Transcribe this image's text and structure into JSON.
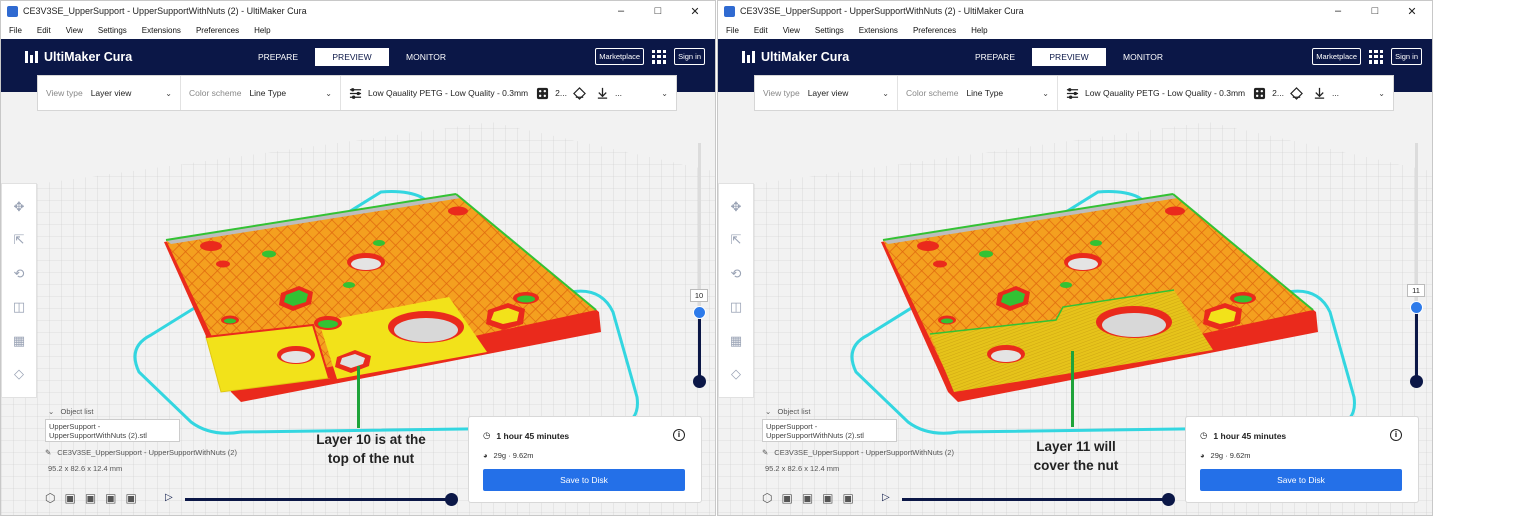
{
  "windows": [
    {
      "title": "CE3V3SE_UpperSupport - UpperSupportWithNuts (2) - UltiMaker Cura",
      "menu": [
        "File",
        "Edit",
        "View",
        "Settings",
        "Extensions",
        "Preferences",
        "Help"
      ],
      "brand": "UltiMaker Cura",
      "stages": [
        "PREPARE",
        "PREVIEW",
        "MONITOR"
      ],
      "marketplace": "Marketplace",
      "signin": "Sign in",
      "view_type_label": "View type",
      "view_type_value": "Layer view",
      "color_scheme_label": "Color scheme",
      "color_scheme_value": "Line Type",
      "profile": "Low Qauality PETG - Low Quality - 0.3mm",
      "support_value": "2...",
      "more": "...",
      "layer": "10",
      "object_list_label": "Object list",
      "object_file": "UpperSupport - UpperSupportWithNuts (2).stl",
      "object_name": "CE3V3SE_UpperSupport - UpperSupportWithNuts (2)",
      "object_dims": "95.2 x 82.6 x 12.4 mm",
      "print_time": "1 hour 45 minutes",
      "material": "29g · 9.62m",
      "save_button": "Save to Disk",
      "annotation_line1": "Layer 10 is at the",
      "annotation_line2": "top of the nut"
    },
    {
      "title": "CE3V3SE_UpperSupport - UpperSupportWithNuts (2) - UltiMaker Cura",
      "menu": [
        "File",
        "Edit",
        "View",
        "Settings",
        "Extensions",
        "Preferences",
        "Help"
      ],
      "brand": "UltiMaker Cura",
      "stages": [
        "PREPARE",
        "PREVIEW",
        "MONITOR"
      ],
      "marketplace": "Marketplace",
      "signin": "Sign in",
      "view_type_label": "View type",
      "view_type_value": "Layer view",
      "color_scheme_label": "Color scheme",
      "color_scheme_value": "Line Type",
      "profile": "Low Qauality PETG - Low Quality - 0.3mm",
      "support_value": "2...",
      "more": "...",
      "layer": "11",
      "object_list_label": "Object list",
      "object_file": "UpperSupport - UpperSupportWithNuts (2).stl",
      "object_name": "CE3V3SE_UpperSupport - UpperSupportWithNuts (2)",
      "object_dims": "95.2 x 82.6 x 12.4 mm",
      "print_time": "1 hour 45 minutes",
      "material": "29g · 9.62m",
      "save_button": "Save to Disk",
      "annotation_line1": "Layer 11 will",
      "annotation_line2": "cover the nut"
    }
  ],
  "colors": {
    "header_navy": "#0b1747",
    "accent_blue": "#2470e8",
    "skirt_cyan": "#33d6e0",
    "wall_red": "#ea2a1c",
    "infill_orange": "#e88a1a",
    "skin_yellow": "#f2e21a",
    "support_green": "#33c233",
    "annotation_green": "#1fa33a"
  }
}
